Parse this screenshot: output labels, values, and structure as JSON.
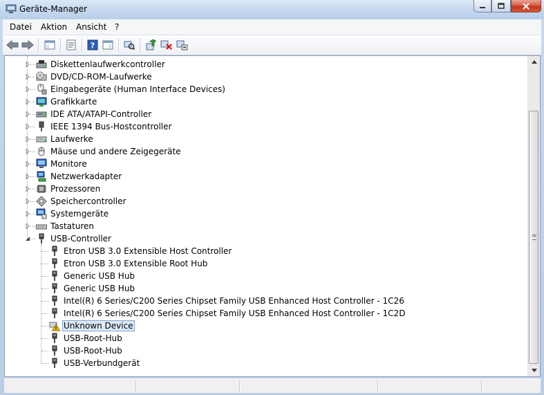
{
  "window": {
    "title": "Geräte-Manager"
  },
  "menu": [
    "Datei",
    "Aktion",
    "Ansicht",
    "?"
  ],
  "toolbar": [
    {
      "name": "back-icon",
      "color": "#3a7ad1"
    },
    {
      "name": "forward-icon",
      "color": "#3a7ad1"
    },
    {
      "name": "show-hide-console-tree-icon"
    },
    {
      "name": "properties-icon"
    },
    {
      "name": "help-icon",
      "color": "#2b5fb4"
    },
    {
      "name": "show-action-pane-icon"
    },
    {
      "name": "scan-hardware-changes-icon"
    },
    {
      "name": "update-driver-icon",
      "color": "#2f8a2f"
    },
    {
      "name": "uninstall-icon",
      "color": "#d11"
    },
    {
      "name": "disable-icon"
    }
  ],
  "tree": {
    "categories": [
      {
        "label": "Diskettenlaufwerkcontroller",
        "icon": "floppy-controller-icon",
        "expanded": false
      },
      {
        "label": "DVD/CD-ROM-Laufwerke",
        "icon": "dvd-drive-icon",
        "expanded": false
      },
      {
        "label": "Eingabegeräte (Human Interface Devices)",
        "icon": "hid-icon",
        "expanded": false
      },
      {
        "label": "Grafikkarte",
        "icon": "display-adapter-icon",
        "expanded": false
      },
      {
        "label": "IDE ATA/ATAPI-Controller",
        "icon": "ide-controller-icon",
        "expanded": false
      },
      {
        "label": "IEEE 1394 Bus-Hostcontroller",
        "icon": "firewire-icon",
        "expanded": false
      },
      {
        "label": "Laufwerke",
        "icon": "disk-drive-icon",
        "expanded": false
      },
      {
        "label": "Mäuse und andere Zeigegeräte",
        "icon": "mouse-icon",
        "expanded": false
      },
      {
        "label": "Monitore",
        "icon": "monitor-icon",
        "expanded": false
      },
      {
        "label": "Netzwerkadapter",
        "icon": "network-adapter-icon",
        "expanded": false
      },
      {
        "label": "Prozessoren",
        "icon": "processor-icon",
        "expanded": false
      },
      {
        "label": "Speichercontroller",
        "icon": "storage-controller-icon",
        "expanded": false
      },
      {
        "label": "Systemgeräte",
        "icon": "system-devices-icon",
        "expanded": false
      },
      {
        "label": "Tastaturen",
        "icon": "keyboard-icon",
        "expanded": false
      },
      {
        "label": "USB-Controller",
        "icon": "usb-controller-icon",
        "expanded": true
      }
    ],
    "usb_children": [
      {
        "label": "Etron USB 3.0 Extensible Host Controller",
        "icon": "usb-device-icon"
      },
      {
        "label": "Etron USB 3.0 Extensible Root Hub",
        "icon": "usb-device-icon"
      },
      {
        "label": "Generic USB Hub",
        "icon": "usb-device-icon"
      },
      {
        "label": "Generic USB Hub",
        "icon": "usb-device-icon"
      },
      {
        "label": "Intel(R) 6 Series/C200 Series Chipset Family USB Enhanced Host Controller - 1C26",
        "icon": "usb-device-icon"
      },
      {
        "label": "Intel(R) 6 Series/C200 Series Chipset Family USB Enhanced Host Controller - 1C2D",
        "icon": "usb-device-icon"
      },
      {
        "label": "Unknown Device",
        "icon": "warning-device-icon",
        "selected": true
      },
      {
        "label": "USB-Root-Hub",
        "icon": "usb-device-icon"
      },
      {
        "label": "USB-Root-Hub",
        "icon": "usb-device-icon"
      },
      {
        "label": "USB-Verbundgerät",
        "icon": "usb-device-icon"
      }
    ]
  },
  "colors": {
    "selection_bg": "#dce9f8",
    "selection_border": "#7da2ce",
    "warning": "#f2c200"
  }
}
